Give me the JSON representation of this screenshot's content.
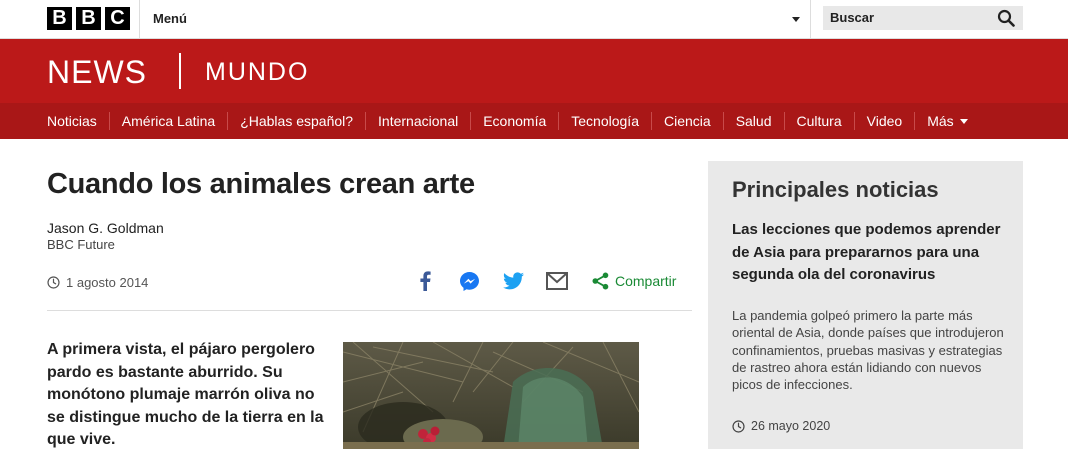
{
  "header": {
    "logo_letters": [
      "B",
      "B",
      "C"
    ],
    "menu_label": "Menú",
    "search_label": "Buscar"
  },
  "brand": {
    "news": "NEWS",
    "section": "MUNDO",
    "color": "#bb1919"
  },
  "nav": {
    "items": [
      "Noticias",
      "América Latina",
      "¿Hablas español?",
      "Internacional",
      "Economía",
      "Tecnología",
      "Ciencia",
      "Salud",
      "Cultura",
      "Video"
    ],
    "more_label": "Más"
  },
  "article": {
    "title": "Cuando los animales crean arte",
    "author": "Jason G. Goldman",
    "source": "BBC Future",
    "date": "1 agosto 2014",
    "share_label": "Compartir",
    "lead": "A primera vista, el pájaro pergolero pardo es bastante aburrido. Su monótono plumaje marrón oliva no se distingue mucho de la tierra en la que vive.",
    "share_icons": [
      "facebook-icon",
      "messenger-icon",
      "twitter-icon",
      "email-icon",
      "share-icon"
    ]
  },
  "sidebar": {
    "title": "Principales noticias",
    "headline": "Las lecciones que podemos aprender de Asia para prepararnos para una segunda ola del coronavirus",
    "summary": "La pandemia golpeó primero la parte más oriental de Asia, donde países que introdujeron confinamientos, pruebas masivas y estrategias de rastreo ahora están lidiando con nuevos picos de infecciones.",
    "date": "26 mayo 2020"
  },
  "colors": {
    "share_green": "#1a8a35",
    "facebook_blue": "#3b5998",
    "twitter_blue": "#1da1f2"
  }
}
